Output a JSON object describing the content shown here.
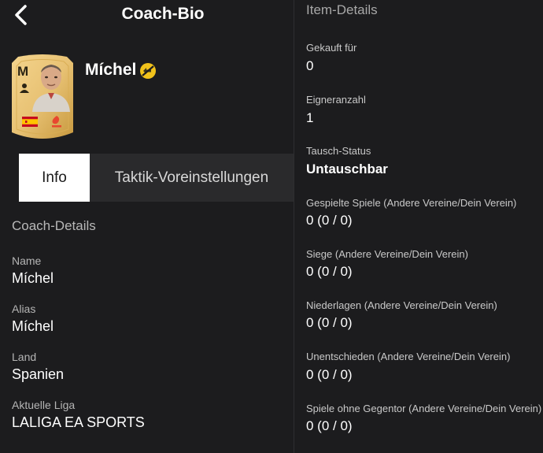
{
  "header": {
    "title": "Coach-Bio",
    "back_icon": "chevron-left-icon"
  },
  "card": {
    "rating_letter": "M",
    "name": "Míchel",
    "colors": {
      "card_gold": "#e8c274",
      "card_gold_dark": "#c8993f"
    },
    "status_icon": "untradeable-icon",
    "status_color": "#f1c21b"
  },
  "tabs": [
    {
      "label": "Info",
      "active": true
    },
    {
      "label": "Taktik-Voreinstellungen",
      "active": false
    }
  ],
  "coach_details": {
    "heading": "Coach-Details",
    "fields": [
      {
        "label": "Name",
        "value": "Míchel"
      },
      {
        "label": "Alias",
        "value": "Míchel"
      },
      {
        "label": "Land",
        "value": "Spanien"
      },
      {
        "label": "Aktuelle Liga",
        "value": "LALIGA EA SPORTS"
      }
    ]
  },
  "item_details": {
    "heading": "Item-Details",
    "fields": [
      {
        "label": "Gekauft für",
        "value": "0"
      },
      {
        "label": "Eigneranzahl",
        "value": "1"
      },
      {
        "label": "Tausch-Status",
        "value": "Untauschbar"
      },
      {
        "label": "Gespielte Spiele (Andere Vereine/Dein Verein)",
        "value": "0 (0 / 0)"
      },
      {
        "label": "Siege (Andere Vereine/Dein Verein)",
        "value": "0 (0 / 0)"
      },
      {
        "label": "Niederlagen (Andere Vereine/Dein Verein)",
        "value": "0 (0 / 0)"
      },
      {
        "label": "Unentschieden (Andere Vereine/Dein Verein)",
        "value": "0 (0 / 0)"
      },
      {
        "label": "Spiele ohne Gegentor (Andere Vereine/Dein Verein)",
        "value": "0 (0 / 0)"
      }
    ]
  }
}
